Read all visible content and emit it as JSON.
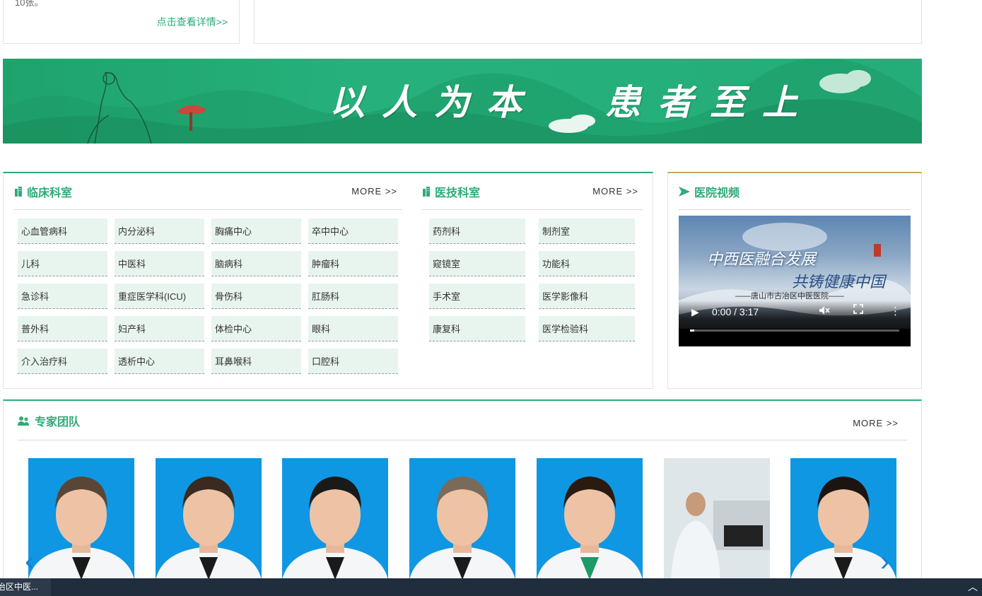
{
  "top": {
    "left_snippet": "10张。",
    "detail_link": "点击查看详情>>",
    "right_snippet": "·"
  },
  "banner": {
    "slogan_left": "以人为本",
    "slogan_right": "患者至上"
  },
  "clinical": {
    "title": "临床科室",
    "more": "MORE >>",
    "items": [
      "心血管病科",
      "内分泌科",
      "胸痛中心",
      "卒中中心",
      "儿科",
      "中医科",
      "脑病科",
      "肿瘤科",
      "急诊科",
      "重症医学科(ICU)",
      "骨伤科",
      "肛肠科",
      "普外科",
      "妇产科",
      "体检中心",
      "眼科",
      "介入治疗科",
      "透析中心",
      "耳鼻喉科",
      "口腔科"
    ]
  },
  "technical": {
    "title": "医技科室",
    "more": "MORE >>",
    "items": [
      "药剂科",
      "制剂室",
      "窥镜室",
      "功能科",
      "手术室",
      "医学影像科",
      "康复科",
      "医学检验科"
    ]
  },
  "video": {
    "title": "医院视频",
    "line1": "中西医融合发展",
    "line2": "共铸健康中国",
    "line3": "——唐山市古冶区中医医院——",
    "time": "0:00 / 3:17",
    "progress": 0.0
  },
  "experts": {
    "title": "专家团队",
    "more": "MORE >>",
    "count": 7
  },
  "bottom": {
    "tab_label": "治区中医...",
    "up_icon": "chevron-up-icon"
  },
  "colors": {
    "accent": "#2fab78",
    "video_accent": "#c9a85b",
    "photo_bg": "#0f97e3"
  }
}
